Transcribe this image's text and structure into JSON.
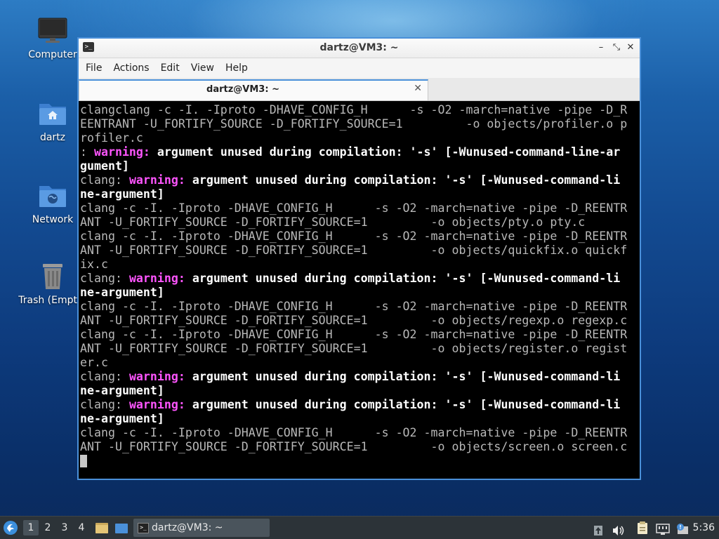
{
  "desktop": {
    "icons": [
      {
        "label": "Computer"
      },
      {
        "label": "dartz"
      },
      {
        "label": "Network"
      },
      {
        "label": "Trash (Empty)"
      }
    ]
  },
  "window": {
    "title": "dartz@VM3: ~",
    "menu": [
      "File",
      "Actions",
      "Edit",
      "View",
      "Help"
    ],
    "tab_label": "dartz@VM3: ~",
    "tab_close": "✕",
    "btn_minimize": "–",
    "btn_maximize": "⤡",
    "btn_close": "✕"
  },
  "terminal": {
    "lines": [
      [
        {
          "t": "clangclang -c -I. -Iproto -DHAVE_CONFIG_H      -s -O2 -march=native -pipe -D_R"
        }
      ],
      [
        {
          "t": "EENTRANT -U_FORTIFY_SOURCE -D_FORTIFY_SOURCE=1         -o objects/profiler.o p"
        }
      ],
      [
        {
          "t": "rofiler.c"
        }
      ],
      [
        {
          "t": ": "
        },
        {
          "t": "warning:",
          "c": "warn"
        },
        {
          "t": " argument unused during compilation: '-s' [-Wunused-command-line-ar",
          "c": "bold"
        }
      ],
      [
        {
          "t": "gument]",
          "c": "bold"
        }
      ],
      [
        {
          "t": "clang: "
        },
        {
          "t": "warning:",
          "c": "warn"
        },
        {
          "t": " argument unused during compilation: '-s' [-Wunused-command-li",
          "c": "bold"
        }
      ],
      [
        {
          "t": "ne-argument]",
          "c": "bold"
        }
      ],
      [
        {
          "t": "clang -c -I. -Iproto -DHAVE_CONFIG_H      -s -O2 -march=native -pipe -D_REENTR"
        }
      ],
      [
        {
          "t": "ANT -U_FORTIFY_SOURCE -D_FORTIFY_SOURCE=1         -o objects/pty.o pty.c"
        }
      ],
      [
        {
          "t": "clang -c -I. -Iproto -DHAVE_CONFIG_H      -s -O2 -march=native -pipe -D_REENTR"
        }
      ],
      [
        {
          "t": "ANT -U_FORTIFY_SOURCE -D_FORTIFY_SOURCE=1         -o objects/quickfix.o quickf"
        }
      ],
      [
        {
          "t": "ix.c"
        }
      ],
      [
        {
          "t": "clang: "
        },
        {
          "t": "warning:",
          "c": "warn"
        },
        {
          "t": " argument unused during compilation: '-s' [-Wunused-command-li",
          "c": "bold"
        }
      ],
      [
        {
          "t": "ne-argument]",
          "c": "bold"
        }
      ],
      [
        {
          "t": "clang -c -I. -Iproto -DHAVE_CONFIG_H      -s -O2 -march=native -pipe -D_REENTR"
        }
      ],
      [
        {
          "t": "ANT -U_FORTIFY_SOURCE -D_FORTIFY_SOURCE=1         -o objects/regexp.o regexp.c"
        }
      ],
      [
        {
          "t": "clang -c -I. -Iproto -DHAVE_CONFIG_H      -s -O2 -march=native -pipe -D_REENTR"
        }
      ],
      [
        {
          "t": "ANT -U_FORTIFY_SOURCE -D_FORTIFY_SOURCE=1         -o objects/register.o regist"
        }
      ],
      [
        {
          "t": "er.c"
        }
      ],
      [
        {
          "t": "clang: "
        },
        {
          "t": "warning:",
          "c": "warn"
        },
        {
          "t": " argument unused during compilation: '-s' [-Wunused-command-li",
          "c": "bold"
        }
      ],
      [
        {
          "t": "ne-argument]",
          "c": "bold"
        }
      ],
      [
        {
          "t": "clang: "
        },
        {
          "t": "warning:",
          "c": "warn"
        },
        {
          "t": " argument unused during compilation: '-s' [-Wunused-command-li",
          "c": "bold"
        }
      ],
      [
        {
          "t": "ne-argument]",
          "c": "bold"
        }
      ],
      [
        {
          "t": "clang -c -I. -Iproto -DHAVE_CONFIG_H      -s -O2 -march=native -pipe -D_REENTR"
        }
      ],
      [
        {
          "t": "ANT -U_FORTIFY_SOURCE -D_FORTIFY_SOURCE=1         -o objects/screen.o screen.c"
        }
      ]
    ]
  },
  "taskbar": {
    "workspaces": [
      "1",
      "2",
      "3",
      "4"
    ],
    "active_workspace": "1",
    "task_label": "dartz@VM3: ~",
    "clock": "5:36",
    "icons": [
      "start-menu-icon",
      "file-manager-icon",
      "show-desktop-icon",
      "terminal-icon",
      "updates-icon",
      "volume-icon",
      "clipboard-icon",
      "network-icon",
      "notifications-icon"
    ]
  },
  "colors": {
    "accent": "#4a90d9",
    "warning": "#ff55ff",
    "taskbar": "#2c3338"
  }
}
